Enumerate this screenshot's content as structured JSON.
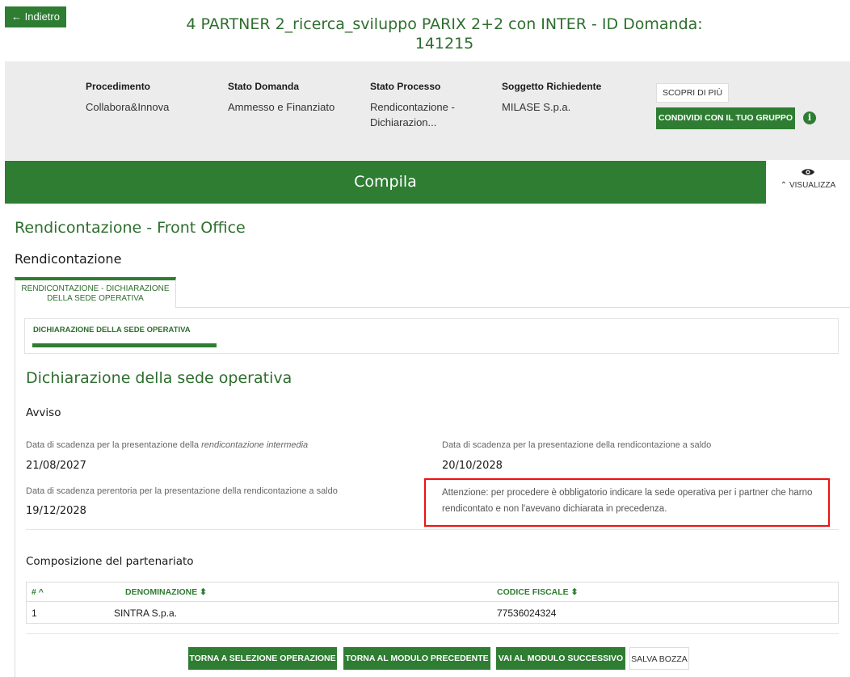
{
  "header": {
    "back_label": "← Indietro",
    "title_line1": "4 PARTNER 2_ricerca_sviluppo PARIX 2+2 con INTER - ID Domanda:",
    "title_line2": "141215"
  },
  "info": {
    "procedimento_label": "Procedimento",
    "procedimento_value": "Collabora&Innova",
    "stato_domanda_label": "Stato Domanda",
    "stato_domanda_value": "Ammesso e Finanziato",
    "stato_processo_label": "Stato Processo",
    "stato_processo_value_line1": "Rendicontazione -",
    "stato_processo_value_line2": "Dichiarazion...",
    "soggetto_label": "Soggetto Richiedente",
    "soggetto_value": "MILASE S.p.a.",
    "scopri_label": "SCOPRI DI PIÙ",
    "condividi_label": "CONDIVIDI CON IL TUO GRUPPO",
    "info_icon_glyph": "i"
  },
  "compila": {
    "title": "Compila",
    "visualizza_label": "⌃ VISUALIZZA",
    "eye_icon": "eye-icon"
  },
  "page": {
    "heading_front": "Rendicontazione - Front Office",
    "heading_rend": "Rendicontazione",
    "tab_main_line1": "RENDICONTAZIONE - DICHIARAZIONE",
    "tab_main_line2": "DELLA SEDE OPERATIVA",
    "subtab_label": "DICHIARAZIONE DELLA SEDE OPERATIVA",
    "heading_dich": "Dichiarazione della sede operativa",
    "heading_avviso": "Avviso"
  },
  "avviso": {
    "intermedia_label_a": "Data di scadenza per la presentazione della ",
    "intermedia_label_b": "rendicontazione intermedia",
    "intermedia_value": "21/08/2027",
    "saldo_label": "Data di scadenza per la presentazione della rendicontazione a saldo",
    "saldo_value": "20/10/2028",
    "perentoria_label": "Data di scadenza perentoria per la presentazione della rendicontazione a saldo",
    "perentoria_value": "19/12/2028",
    "note_text": "Attenzione: per procedere è obbligatorio indicare la sede operativa per i partner che harno rendicontato e non l'avevano dichiarata in precedenza."
  },
  "partenariato": {
    "heading": "Composizione del partenariato",
    "columns": [
      "# ^",
      "DENOMINAZIONE ⬍",
      "CODICE FISCALE ⬍"
    ],
    "rows": [
      {
        "num": "1",
        "denominazione": "SINTRA S.p.a.",
        "codice_fiscale": "77536024324"
      }
    ]
  },
  "footer": {
    "torna_selezione": "TORNA A SELEZIONE OPERAZIONE",
    "torna_precedente": "TORNA AL MODULO PRECEDENTE",
    "vai_successivo": "VAI AL MODULO SUCCESSIVO",
    "salva_bozza": "SALVA BOZZA"
  },
  "colors": {
    "brand_green": "#2e7d32",
    "heading_green": "#2e6e2e",
    "info_band": "#ececec",
    "highlight_red": "#ee1111"
  }
}
